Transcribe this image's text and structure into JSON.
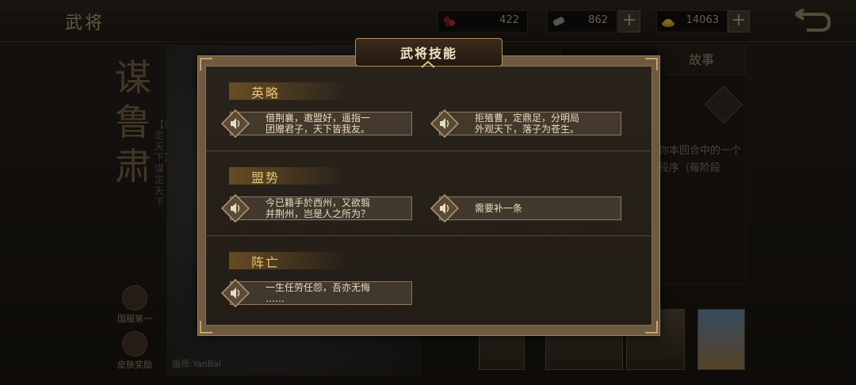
{
  "header": {
    "title": "武将",
    "resources": [
      {
        "icon": "gem-icon",
        "value": "422"
      },
      {
        "icon": "scroll-icon",
        "value": "862"
      },
      {
        "icon": "gold-ingot-icon",
        "value": "14063"
      }
    ],
    "plus_label": "+"
  },
  "general": {
    "name_vertical": "谋鲁肃",
    "title_vertical": "【谋定天下】谋定天下"
  },
  "left_menu": [
    {
      "label": "国服第一",
      "icon": "crest-icon"
    },
    {
      "label": "皮肤奖励",
      "icon": "peach-icon"
    }
  ],
  "portrait": {
    "painter": "画师:YanBai"
  },
  "right_panel": {
    "tab_story": "故事",
    "desc": "令你本回合中的一个阶段序（每阶段"
  },
  "modal": {
    "title": "武将技能",
    "sections": [
      {
        "label": "英略",
        "lines": [
          "借荆襄，邀盟好，遥指一\n团赠君子，天下皆我友。",
          "拒殖曹，定鼎足，分明局\n外观天下，落子为苍生。"
        ]
      },
      {
        "label": "盟势",
        "lines": [
          "今已籍手於西州，又欲翦\n并荆州，岂是人之所为？",
          "需要补一条"
        ]
      },
      {
        "label": "阵亡",
        "lines": [
          "一生任劳任怨，吾亦无悔\n……"
        ]
      }
    ]
  },
  "colors": {
    "accent_gold": "#e6c46e",
    "frame": "#a08460",
    "text_light": "#e8dcc2"
  }
}
